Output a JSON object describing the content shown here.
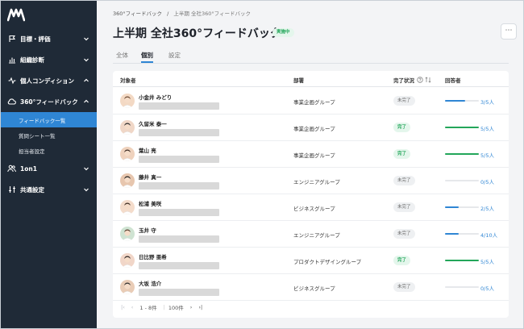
{
  "sidebar": {
    "items": [
      {
        "label": "目標・評価",
        "icon": "flag-icon"
      },
      {
        "label": "組織診断",
        "icon": "bar-chart-icon"
      },
      {
        "label": "個人コンディション",
        "icon": "pulse-icon"
      },
      {
        "label": "360°フィードバック",
        "icon": "cloud-icon"
      },
      {
        "label": "1on1",
        "icon": "users-icon"
      },
      {
        "label": "共通設定",
        "icon": "sliders-icon"
      }
    ],
    "sub_items": [
      {
        "label": "フィードバック一覧"
      },
      {
        "label": "質問シート一覧"
      },
      {
        "label": "担当者設定"
      }
    ]
  },
  "breadcrumb": {
    "parent": "360°フィードバック",
    "sep": "/",
    "current": "上半期 全社360°フィードバック"
  },
  "page": {
    "title": "上半期 全社360°フィードバック",
    "status": "実施中",
    "more": "⋯"
  },
  "tabs": [
    {
      "label": "全体"
    },
    {
      "label": "個別"
    },
    {
      "label": "設定"
    }
  ],
  "table": {
    "headers": {
      "target": "対象者",
      "dept": "部署",
      "status": "完了状況",
      "respondents": "回答者"
    },
    "rows": [
      {
        "name": "小金井 みどり",
        "dept": "事業企画グループ",
        "status": "未完了",
        "done": false,
        "count": "3/5人",
        "progress": 0.6
      },
      {
        "name": "久留米 泰一",
        "dept": "事業企画グループ",
        "status": "完了",
        "done": true,
        "count": "5/5人",
        "progress": 1.0
      },
      {
        "name": "葉山 亮",
        "dept": "事業企画グループ",
        "status": "完了",
        "done": true,
        "count": "5/5人",
        "progress": 1.0
      },
      {
        "name": "藤井 真一",
        "dept": "エンジニアグループ",
        "status": "未完了",
        "done": false,
        "count": "0/5人",
        "progress": 0.0
      },
      {
        "name": "松浦 美咲",
        "dept": "ビジネスグループ",
        "status": "未完了",
        "done": false,
        "count": "2/5人",
        "progress": 0.4
      },
      {
        "name": "玉井 守",
        "dept": "エンジニアグループ",
        "status": "未完了",
        "done": false,
        "count": "4/10人",
        "progress": 0.4
      },
      {
        "name": "日比野 亜希",
        "dept": "プロダクトデザイングループ",
        "status": "完了",
        "done": true,
        "count": "5/5人",
        "progress": 1.0
      },
      {
        "name": "大坂 浩介",
        "dept": "ビジネスグループ",
        "status": "未完了",
        "done": false,
        "count": "0/5人",
        "progress": 0.0
      }
    ]
  },
  "pager": {
    "first": "|‹",
    "prev": "‹",
    "range": "1 - 8件",
    "per_page": "100件",
    "next": "›",
    "last": "›|"
  },
  "colors": {
    "accent": "#2f86d4",
    "done": "#23a65a",
    "sidebar": "#1f2a37"
  }
}
